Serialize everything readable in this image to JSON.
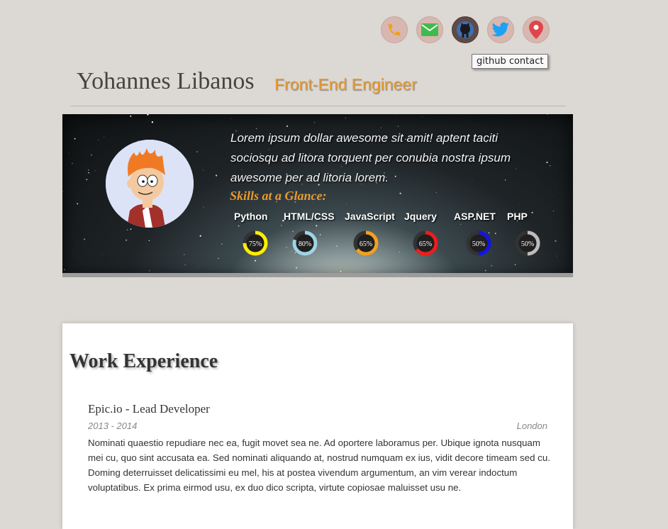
{
  "header": {
    "name": "Yohannes Libanos",
    "role": "Front-End Engineer",
    "tooltip": "github contact"
  },
  "social": [
    {
      "icon": "phone-icon",
      "color": "#f0a020"
    },
    {
      "icon": "email-icon",
      "color": "#3fbb4c"
    },
    {
      "icon": "github-icon",
      "color": "#3d6fb5"
    },
    {
      "icon": "twitter-icon",
      "color": "#1da1f2"
    },
    {
      "icon": "location-icon",
      "color": "#e0454b"
    }
  ],
  "hero": {
    "intro": "Lorem ipsum dollar awesome sit amit! aptent taciti sociosqu ad litora torquent per conubia nostra ipsum awesome per ad litoria lorem.",
    "skills_title": "Skills at a Glance:",
    "skills": [
      {
        "label": "Python",
        "percent": 75,
        "percent_text": "75%",
        "color": "#ffee00"
      },
      {
        "label": "HTML/CSS",
        "percent": 80,
        "percent_text": "80%",
        "color": "#9ed4e6"
      },
      {
        "label": "JavaScript",
        "percent": 65,
        "percent_text": "65%",
        "color": "#f4a020"
      },
      {
        "label": "Jquery",
        "percent": 65,
        "percent_text": "65%",
        "color": "#ee1c1c"
      },
      {
        "label": "ASP.NET",
        "percent": 50,
        "percent_text": "50%",
        "color": "#1414e0"
      },
      {
        "label": "PHP",
        "percent": 50,
        "percent_text": "50%",
        "color": "#bbbbbb"
      }
    ]
  },
  "work": {
    "title": "Work Experience",
    "jobs": [
      {
        "title": "Epic.io - Lead Developer",
        "dates": "2013 - 2014",
        "location": "London",
        "description": "Nominati quaestio repudiare nec ea, fugit movet sea ne. Ad oportere laboramus per. Ubique ignota nusquam mei cu, quo sint accusata ea. Sed nominati aliquando at, nostrud numquam ex ius, vidit decore timeam sed cu. Doming deterruisset delicatissimi eu mel, his at postea vivendum argumentum, an vim verear indoctum voluptatibus. Ex prima eirmod usu, ex duo dico scripta, virtute copiosae maluisset usu ne."
      }
    ]
  }
}
